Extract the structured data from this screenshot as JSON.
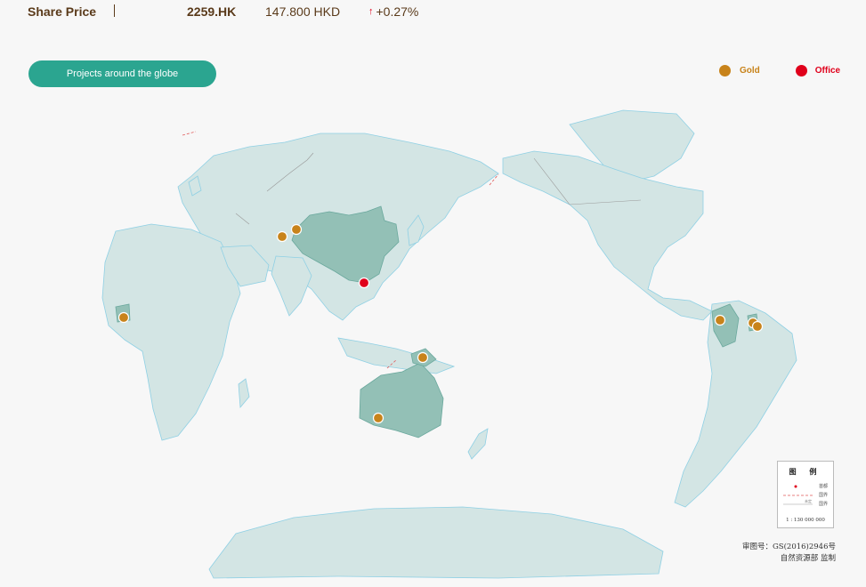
{
  "ticker": {
    "label": "Share Price",
    "code": "2259.HK",
    "price": "147.800 HKD",
    "change": "+0.27%",
    "change_icon": "arrow-up-icon"
  },
  "projects_button": {
    "label": "Projects around the globe"
  },
  "legend": {
    "gold": {
      "label": "Gold",
      "color": "#c8831a"
    },
    "office": {
      "label": "Office",
      "color": "#e0001b"
    }
  },
  "map_legend": {
    "title": "图  例",
    "capital": "首都",
    "undetermined": "未定",
    "undetermined_border": "国界",
    "border": "国界",
    "scale": "1 : 130 000 000"
  },
  "approval": {
    "line1": "审图号：GS(2016)2946号",
    "line2": "自然资源部 监制"
  },
  "colors": {
    "land": "#d3e5e4",
    "highlight": "#93c0b6",
    "ocean": "#f7f7f7",
    "accent": "#2ba590"
  }
}
